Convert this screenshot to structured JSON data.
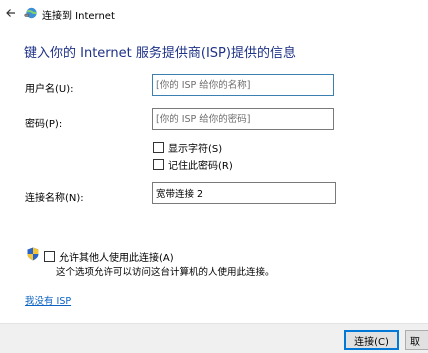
{
  "titlebar": {
    "title": "连接到 Internet",
    "back_icon": "arrow-left-icon",
    "app_icon": "network-globe-icon"
  },
  "heading": "键入你的 Internet 服务提供商(ISP)提供的信息",
  "form": {
    "username": {
      "label": "用户名(U):",
      "value": "",
      "placeholder": "[你的 ISP 给你的名称]"
    },
    "password": {
      "label": "密码(P):",
      "value": "",
      "placeholder": "[你的 ISP 给你的密码]"
    },
    "show_chars": {
      "label": "显示字符(S)",
      "checked": false
    },
    "remember_password": {
      "label": "记住此密码(R)",
      "checked": false
    },
    "connection_name": {
      "label": "连接名称(N):",
      "value": "宽带连接 2"
    },
    "allow_others": {
      "label": "允许其他人使用此连接(A)",
      "checked": false,
      "note": "这个选项允许可以访问这台计算机的人使用此连接。"
    }
  },
  "no_isp_link": "我没有 ISP",
  "footer": {
    "connect_label": "连接(C)",
    "cancel_label": "取"
  },
  "colors": {
    "heading": "#1e3287",
    "link": "#0b62c4",
    "footer_bg": "#f0f0f0",
    "default_button_border": "#0078d7"
  }
}
